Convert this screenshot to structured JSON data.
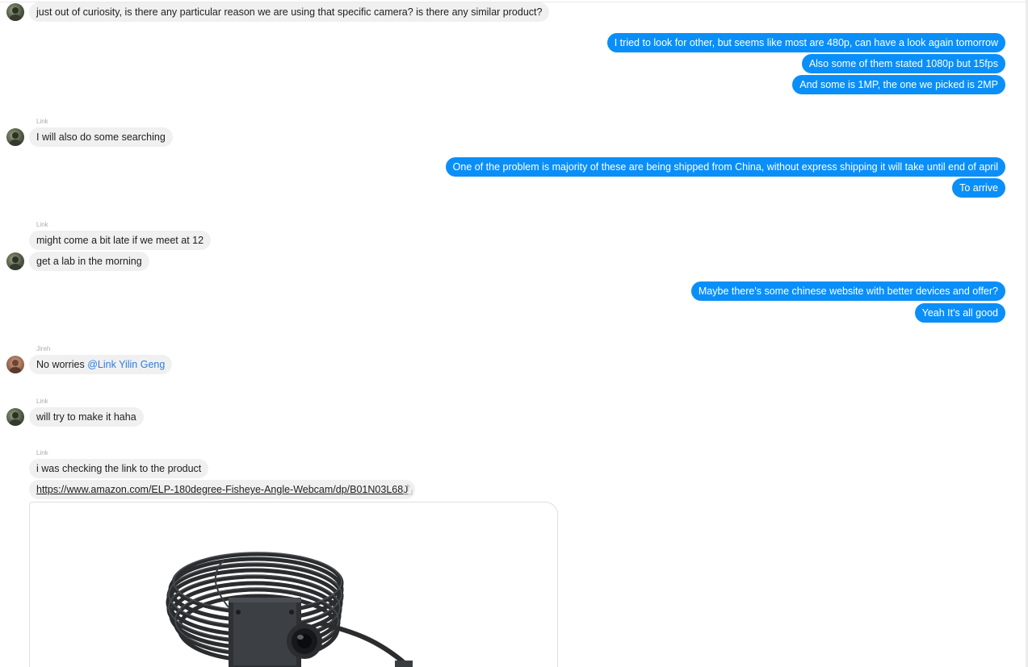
{
  "messages": {
    "m1": "just out of curiosity, is there any particular reason we are using that specific camera? is there any similar   product?",
    "m2": "I tried to look for other, but seems like most are 480p, can have a look again tomorrow",
    "m3": "Also some of them stated 1080p but 15fps",
    "m4": "And some is 1MP, the one we picked is 2MP",
    "m5_sender": "Link",
    "m5": "I will also do some searching",
    "m6": "One of the problem is majority of these are being shipped from China, without express shipping it will take until end of april",
    "m7": "To arrive",
    "m8_sender": "Link",
    "m8": "might come a bit late if we meet at 12",
    "m9": "get a lab in the morning",
    "m10": "Maybe there's some chinese website with better devices and offer?",
    "m11": "Yeah It's all good",
    "m12_sender": "Jireh",
    "m12_text": "No worries ",
    "m12_mention": "@Link Yilin Geng",
    "m13_sender": "Link",
    "m13": "will try to make it haha",
    "m14_sender": "Link",
    "m14": "i was checking the link to the product",
    "m15_url": "https://www.amazon.com/ELP-180degree-Fisheye-Angle-Webcam/dp/B01N03L68J"
  },
  "colors": {
    "outgoing_bubble": "#0a8ff9",
    "incoming_bubble": "#f1f0f0",
    "mention": "#2b7de1"
  },
  "icons": {
    "share": "share-icon",
    "preview": "product-camera-image"
  }
}
